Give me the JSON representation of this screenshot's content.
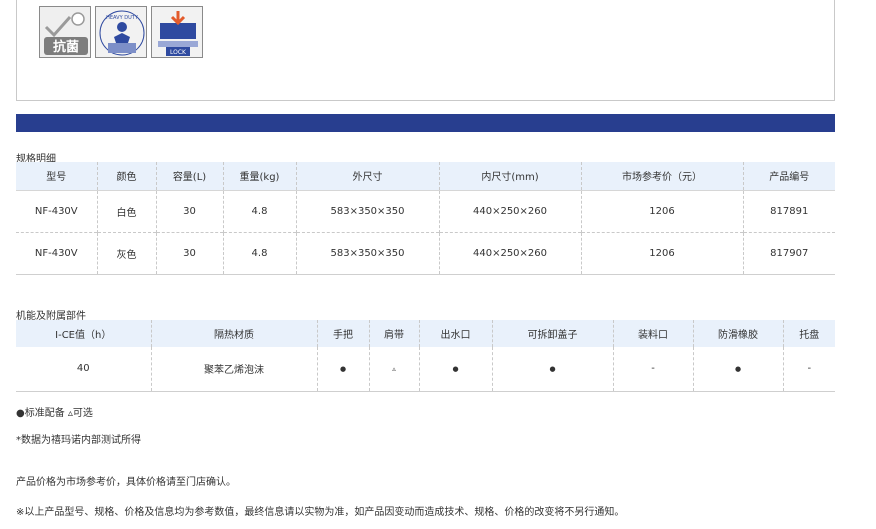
{
  "features": {
    "icons": [
      {
        "name": "antibacterial-icon",
        "label": "抗菌"
      },
      {
        "name": "heavy-duty-icon",
        "label": "HEAVY DUTY"
      },
      {
        "name": "lock-icon",
        "label": "LOCK"
      }
    ]
  },
  "spec": {
    "title": "规格明细",
    "headers": [
      "型号",
      "颜色",
      "容量(L)",
      "重量(kg)",
      "外尺寸",
      "内尺寸(mm)",
      "市场参考价（元）",
      "产品编号"
    ],
    "rows": [
      [
        "NF-430V",
        "白色",
        "30",
        "4.8",
        "583×350×350",
        "440×250×260",
        "1206",
        "817891"
      ],
      [
        "NF-430V",
        "灰色",
        "30",
        "4.8",
        "583×350×350",
        "440×250×260",
        "1206",
        "817907"
      ]
    ]
  },
  "features_table": {
    "title": "机能及附属部件",
    "headers": [
      "I-CE值（h）",
      "隔热材质",
      "手把",
      "肩带",
      "出水口",
      "可拆卸盖子",
      "装料口",
      "防滑橡胶",
      "托盘"
    ],
    "row": [
      "40",
      "聚苯乙烯泡沫",
      "●",
      "▵",
      "●",
      "●",
      "-",
      "●",
      "-"
    ]
  },
  "notes": {
    "legend": "●标准配备 ▵可选",
    "test": "*数据为禧玛诺内部测试所得",
    "price": "产品价格为市场参考价，具体价格请至门店确认。",
    "disclaimer": "※以上产品型号、规格、价格及信息均为参考数值，最终信息请以实物为准，如产品因变动而造成技术、规格、价格的改变将不另行通知。"
  },
  "colors": {
    "accent_bar": "#283e8f",
    "header_bg": "#e9f1fb"
  }
}
